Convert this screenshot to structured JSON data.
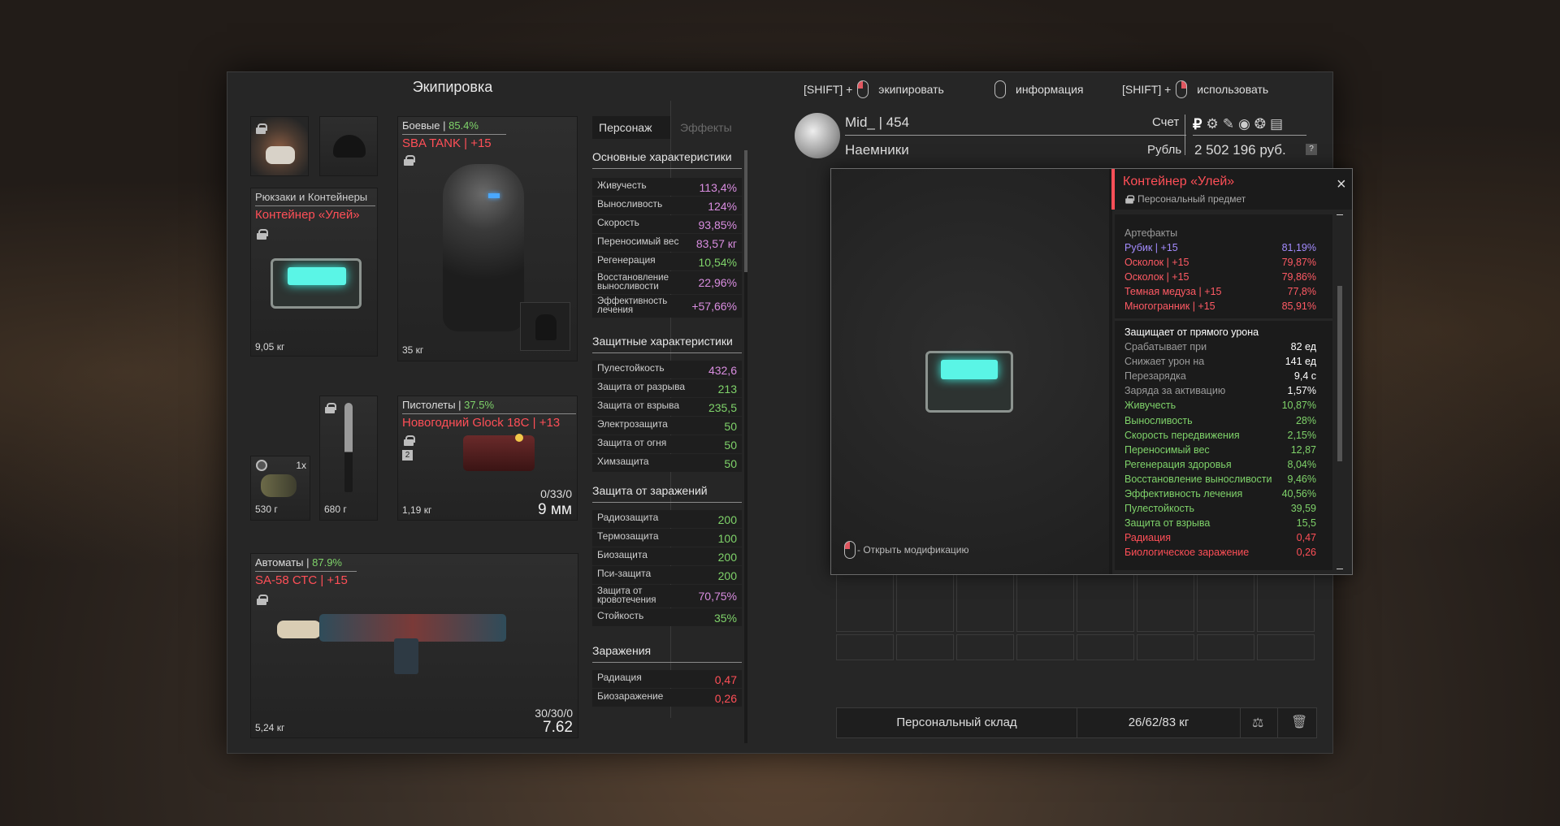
{
  "header": {
    "title": "Экипировка",
    "hint1_prefix": "[SHIFT] +",
    "hint1": "экипировать",
    "hint2": "информация",
    "hint3_prefix": "[SHIFT] +",
    "hint3": "использовать"
  },
  "player": {
    "name": "Mid_ | 454",
    "faction": "Наемники",
    "account_label": "Счет",
    "currency_label": "Рубль",
    "balance": "2 502 196 руб.",
    "help": "?"
  },
  "backpack": {
    "category": "Рюкзаки и Контейнеры",
    "name": "Контейнер «Улей»",
    "weight": "9,05 кг"
  },
  "armor": {
    "category": "Боевые",
    "percent": "85.4%",
    "sep": " | ",
    "name": "SBA TANK | +15",
    "weight": "35 кг"
  },
  "grenade": {
    "count": "1x",
    "weight": "530 г"
  },
  "knife": {
    "weight": "680 г"
  },
  "pistol": {
    "category": "Пистолеты",
    "percent": "37.5%",
    "sep": " | ",
    "name": "Новогодний Glock 18C | +13",
    "badge": "2",
    "ammo": "0/33/0",
    "caliber": "9 мм",
    "weight": "1,19 кг"
  },
  "rifle": {
    "category": "Автоматы",
    "percent": "87.9%",
    "sep": " | ",
    "name": "SA-58 СТС | +15",
    "ammo": "30/30/0",
    "caliber": "7.62",
    "weight": "5,24 кг"
  },
  "stats_tabs": {
    "tab1": "Персонаж",
    "tab2": "Эффекты"
  },
  "stats": {
    "basic_title": "Основные характеристики",
    "basic": [
      [
        "Живучесть",
        "113,4%",
        "#d98de0"
      ],
      [
        "Выносливость",
        "124%",
        "#d98de0"
      ],
      [
        "Скорость",
        "93,85%",
        "#d98de0"
      ],
      [
        "Переносимый вес",
        "83,57 кг",
        "#d98de0"
      ],
      [
        "Регенерация",
        "10,54%",
        "#7fd36a"
      ],
      [
        "Восстановление выносливости",
        "22,96%",
        "#d98de0"
      ],
      [
        "Эффективность лечения",
        "+57,66%",
        "#d98de0"
      ]
    ],
    "protect_title": "Защитные характеристики",
    "protect": [
      [
        "Пулестойкость",
        "432,6",
        "#d98de0"
      ],
      [
        "Защита от разрыва",
        "213",
        "#7fd36a"
      ],
      [
        "Защита от взрыва",
        "235,5",
        "#7fd36a"
      ],
      [
        "Электрозащита",
        "50",
        "#7fd36a"
      ],
      [
        "Защита от огня",
        "50",
        "#7fd36a"
      ],
      [
        "Химзащита",
        "50",
        "#7fd36a"
      ]
    ],
    "infect_title": "Защита от заражений",
    "infect": [
      [
        "Радиозащита",
        "200",
        "#7fd36a"
      ],
      [
        "Термозащита",
        "100",
        "#7fd36a"
      ],
      [
        "Биозащита",
        "200",
        "#7fd36a"
      ],
      [
        "Пси-защита",
        "200",
        "#7fd36a"
      ],
      [
        "Защита от кровотечения",
        "70,75%",
        "#d98de0"
      ],
      [
        "Стойкость",
        "35%",
        "#7fd36a"
      ]
    ],
    "contam_title": "Заражения",
    "contam": [
      [
        "Радиация",
        "0,47",
        "#ff4f57"
      ],
      [
        "Биозаражение",
        "0,26",
        "#ff4f57"
      ]
    ]
  },
  "tooltip": {
    "name": "Контейнер «Улей»",
    "personal": "Персональный предмет",
    "modify_hint": "- Открыть модификацию",
    "close": "×",
    "artifacts_title": "Артефакты",
    "artifacts": [
      [
        "Рубик | +15",
        "81,19%",
        "#a48cff"
      ],
      [
        "Осколок | +15",
        "79,87%",
        "#ff5a64"
      ],
      [
        "Осколок | +15",
        "79,86%",
        "#ff5a64"
      ],
      [
        "Темная медуза | +15",
        "77,8%",
        "#ff5a64"
      ],
      [
        "Многогранник | +15",
        "85,91%",
        "#ff5a64"
      ]
    ],
    "effect_title": "Защищает от прямого урона",
    "effects": [
      [
        "Срабатывает при",
        "82 ед",
        "#9a9a9a",
        "#ffffff"
      ],
      [
        "Снижает урон на",
        "141 ед",
        "#9a9a9a",
        "#ffffff"
      ],
      [
        "Перезарядка",
        "9,4 с",
        "#9a9a9a",
        "#ffffff"
      ],
      [
        "Заряда за активацию",
        "1,57%",
        "#9a9a9a",
        "#ffffff"
      ],
      [
        "Живучесть",
        "10,87%",
        "#7fd36a",
        "#7fd36a"
      ],
      [
        "Выносливость",
        "28%",
        "#7fd36a",
        "#7fd36a"
      ],
      [
        "Скорость передвижения",
        "2,15%",
        "#7fd36a",
        "#7fd36a"
      ],
      [
        "Переносимый вес",
        "12,87",
        "#7fd36a",
        "#7fd36a"
      ],
      [
        "Регенерация здоровья",
        "8,04%",
        "#7fd36a",
        "#7fd36a"
      ],
      [
        "Восстановление выносливости",
        "9,46%",
        "#7fd36a",
        "#7fd36a"
      ],
      [
        "Эффективность лечения",
        "40,56%",
        "#7fd36a",
        "#7fd36a"
      ],
      [
        "Пулестойкость",
        "39,59",
        "#7fd36a",
        "#7fd36a"
      ],
      [
        "Защита от взрыва",
        "15,5",
        "#7fd36a",
        "#7fd36a"
      ],
      [
        "Радиация",
        "0,47",
        "#ff4f57",
        "#ff4f57"
      ],
      [
        "Биологическое заражение",
        "0,26",
        "#ff4f57",
        "#ff4f57"
      ]
    ]
  },
  "storage": {
    "label": "Персональный склад",
    "weight": "26/62/83 кг"
  }
}
